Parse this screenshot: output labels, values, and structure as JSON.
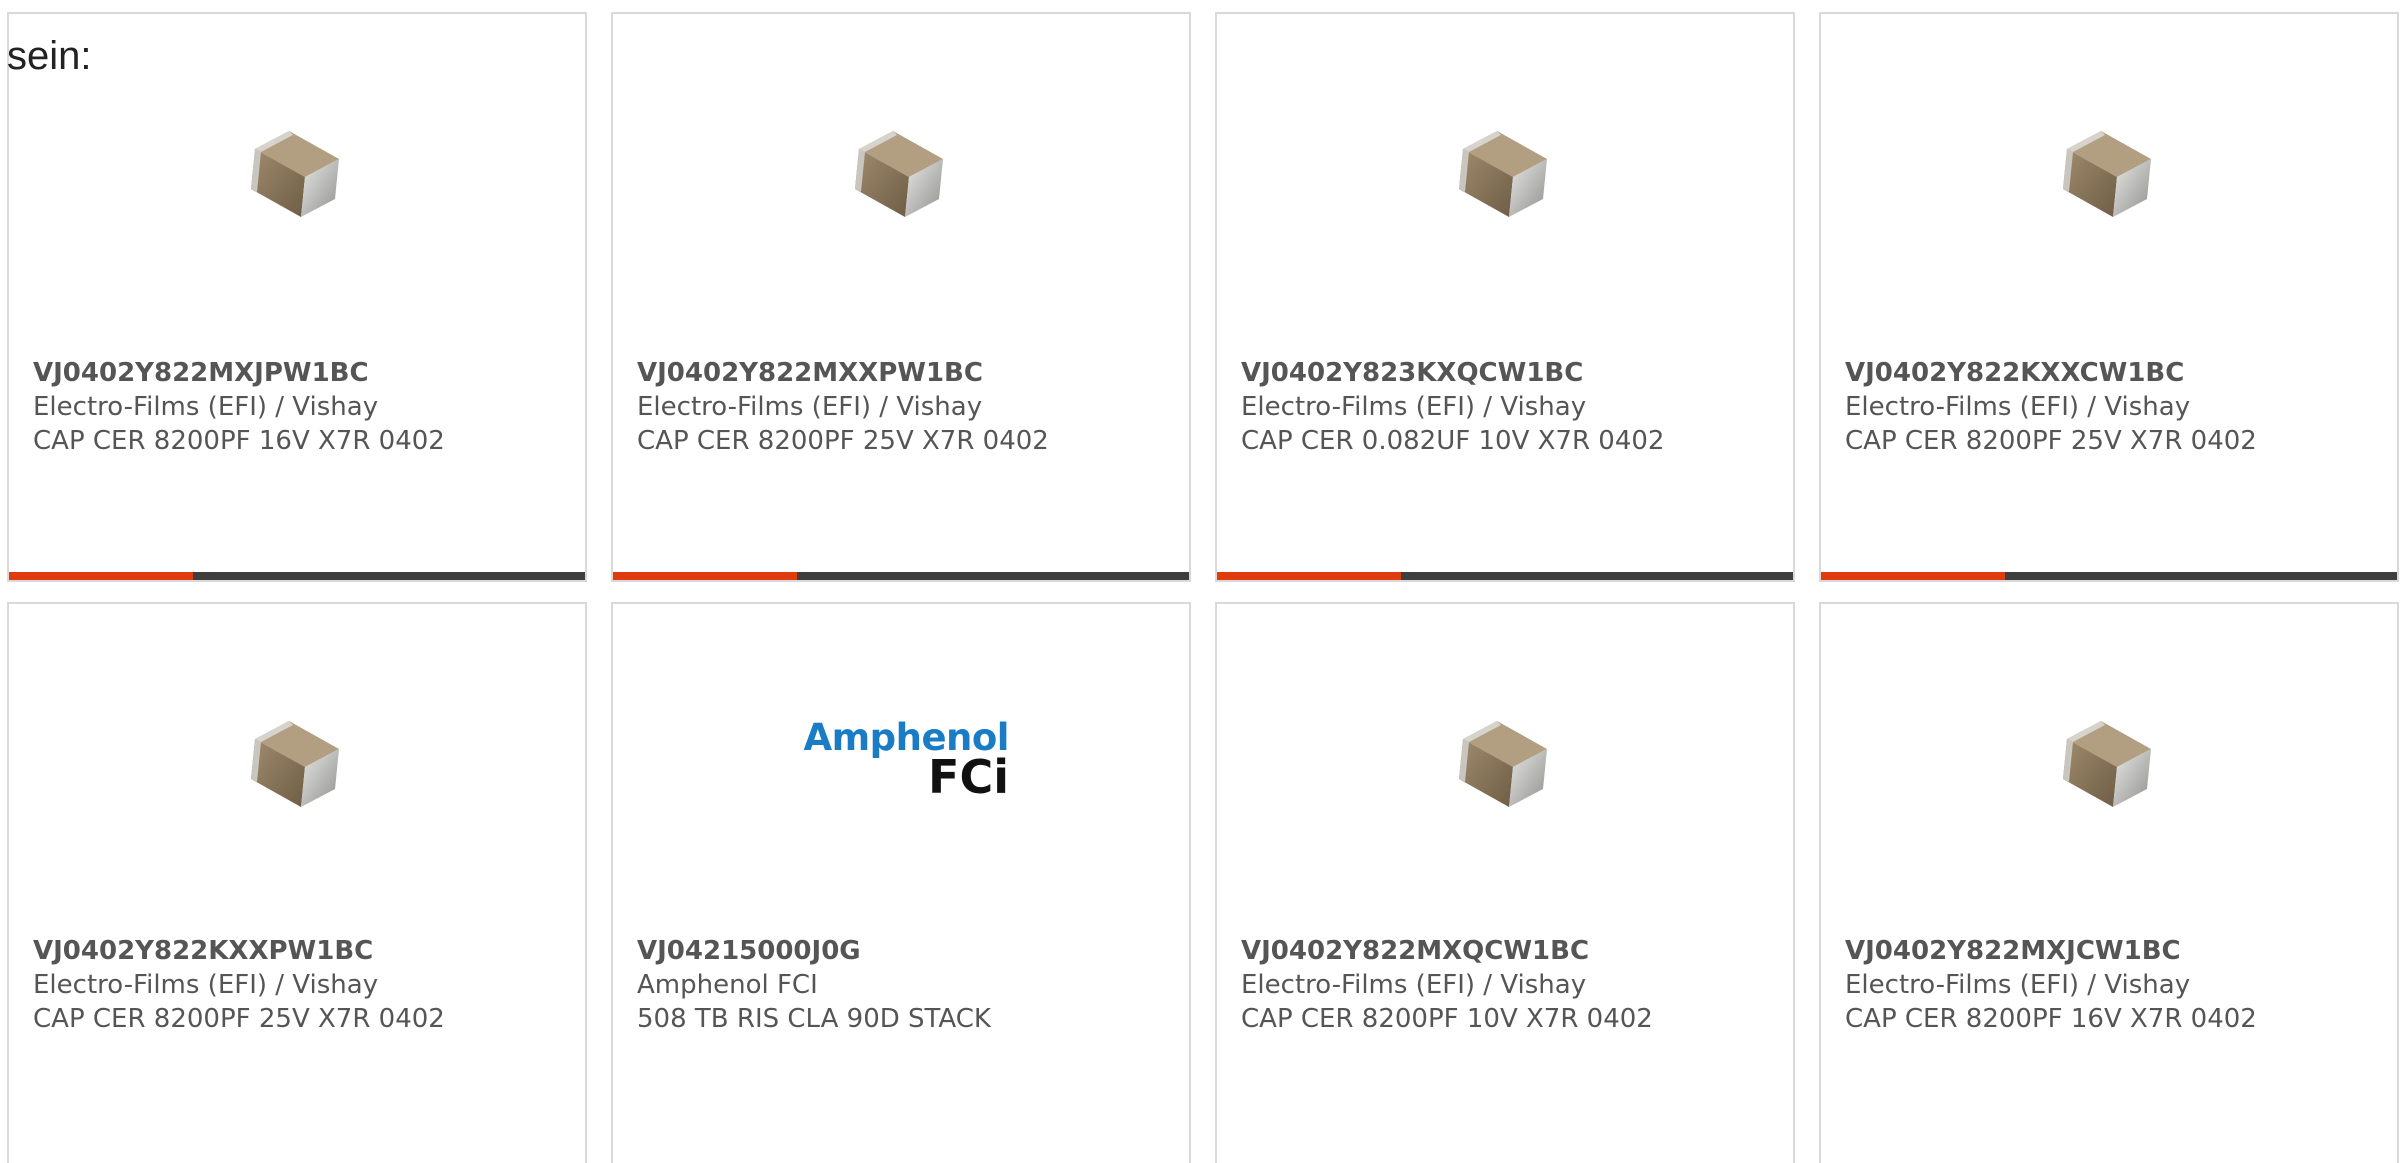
{
  "intro_text": "sein:",
  "accent_color": "#e03a0f",
  "bar_track_color": "#3e3e3e",
  "cards": [
    {
      "part_number": "VJ0402Y822MXJPW1BC",
      "manufacturer": "Electro-Films (EFI) / Vishay",
      "description": "CAP CER 8200PF 16V X7R 0402",
      "image": "ceramic-capacitor-chip",
      "progress": 0.32
    },
    {
      "part_number": "VJ0402Y822MXXPW1BC",
      "manufacturer": "Electro-Films (EFI) / Vishay",
      "description": "CAP CER 8200PF 25V X7R 0402",
      "image": "ceramic-capacitor-chip",
      "progress": 0.32
    },
    {
      "part_number": "VJ0402Y823KXQCW1BC",
      "manufacturer": "Electro-Films (EFI) / Vishay",
      "description": "CAP CER 0.082UF 10V X7R 0402",
      "image": "ceramic-capacitor-chip",
      "progress": 0.32
    },
    {
      "part_number": "VJ0402Y822KXXCW1BC",
      "manufacturer": "Electro-Films (EFI) / Vishay",
      "description": "CAP CER 8200PF 25V X7R 0402",
      "image": "ceramic-capacitor-chip",
      "progress": 0.32
    },
    {
      "part_number": "VJ0402Y822KXXPW1BC",
      "manufacturer": "Electro-Films (EFI) / Vishay",
      "description": "CAP CER 8200PF 25V X7R 0402",
      "image": "ceramic-capacitor-chip"
    },
    {
      "part_number": "VJ04215000J0G",
      "manufacturer": "Amphenol FCI",
      "description": "508 TB RIS CLA 90D STACK",
      "image": "amphenol-fci-logo",
      "logo_line1": "Amphenol",
      "logo_line2": "FCi"
    },
    {
      "part_number": "VJ0402Y822MXQCW1BC",
      "manufacturer": "Electro-Films (EFI) / Vishay",
      "description": "CAP CER 8200PF 10V X7R 0402",
      "image": "ceramic-capacitor-chip"
    },
    {
      "part_number": "VJ0402Y822MXJCW1BC",
      "manufacturer": "Electro-Films (EFI) / Vishay",
      "description": "CAP CER 8200PF 16V X7R 0402",
      "image": "ceramic-capacitor-chip"
    }
  ]
}
